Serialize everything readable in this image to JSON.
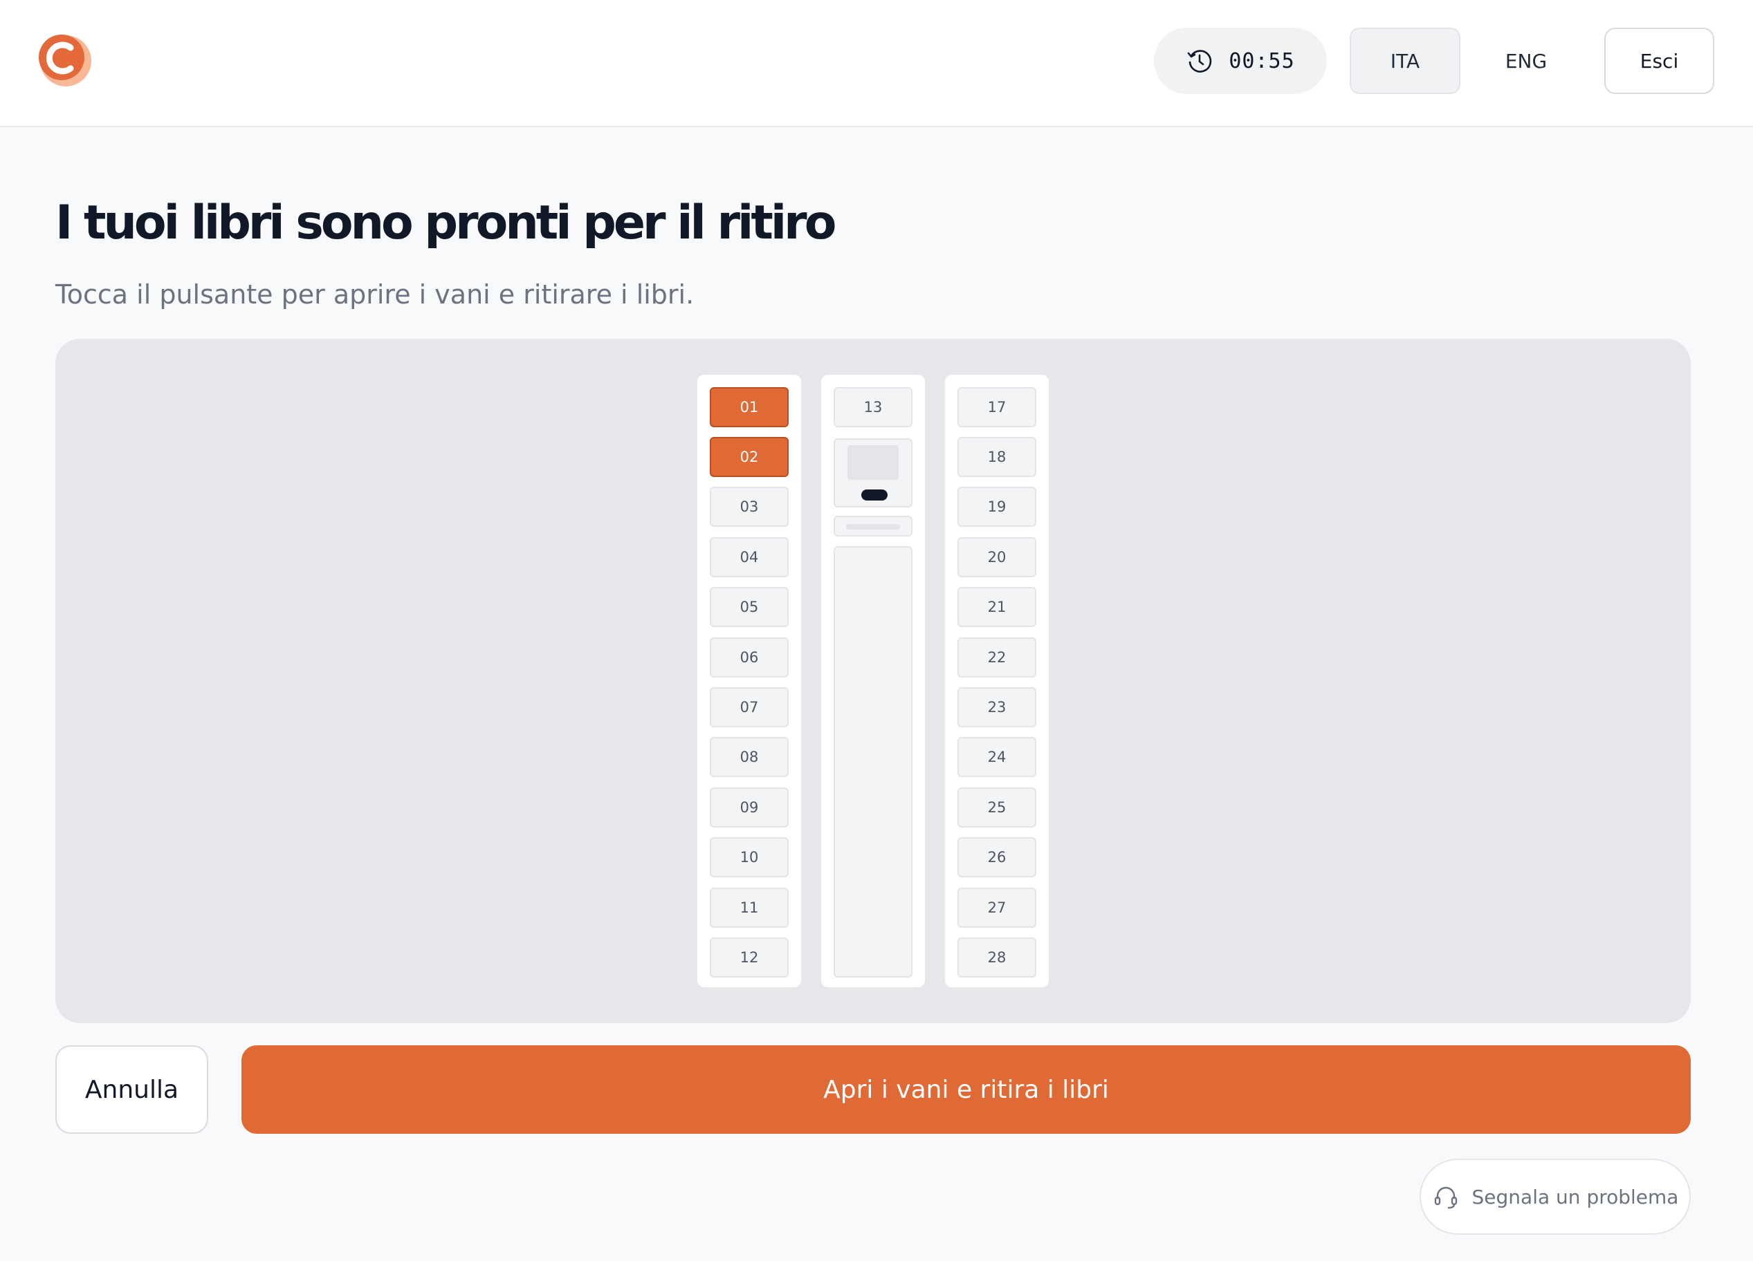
{
  "header": {
    "logo_icon": "c-logo-icon",
    "timer": {
      "icon": "clock-history-icon",
      "value": "00:55"
    },
    "languages": [
      {
        "label": "ITA",
        "active": true
      },
      {
        "label": "ENG",
        "active": false
      }
    ],
    "exit_label": "Esci"
  },
  "main": {
    "title": "I tuoi libri sono pronti per il ritiro",
    "subtitle": "Tocca il pulsante per aprire i vani e ritirare i libri."
  },
  "locker": {
    "column_a": [
      {
        "label": "01",
        "selected": true
      },
      {
        "label": "02",
        "selected": true
      },
      {
        "label": "03",
        "selected": false
      },
      {
        "label": "04",
        "selected": false
      },
      {
        "label": "05",
        "selected": false
      },
      {
        "label": "06",
        "selected": false
      },
      {
        "label": "07",
        "selected": false
      },
      {
        "label": "08",
        "selected": false
      },
      {
        "label": "09",
        "selected": false
      },
      {
        "label": "10",
        "selected": false
      },
      {
        "label": "11",
        "selected": false
      },
      {
        "label": "12",
        "selected": false
      }
    ],
    "column_b_top": {
      "label": "13",
      "selected": false
    },
    "column_c": [
      {
        "label": "17",
        "selected": false
      },
      {
        "label": "18",
        "selected": false
      },
      {
        "label": "19",
        "selected": false
      },
      {
        "label": "20",
        "selected": false
      },
      {
        "label": "21",
        "selected": false
      },
      {
        "label": "22",
        "selected": false
      },
      {
        "label": "23",
        "selected": false
      },
      {
        "label": "24",
        "selected": false
      },
      {
        "label": "25",
        "selected": false
      },
      {
        "label": "26",
        "selected": false
      },
      {
        "label": "27",
        "selected": false
      },
      {
        "label": "28",
        "selected": false
      }
    ]
  },
  "actions": {
    "cancel_label": "Annulla",
    "primary_label": "Apri i vani e ritira i libri",
    "report_label": "Segnala un problema",
    "report_icon": "headset-icon"
  },
  "colors": {
    "accent": "#df6a35",
    "accent_border": "#b94f21",
    "panel": "#e5e7eb",
    "background": "#f8f9fa"
  }
}
